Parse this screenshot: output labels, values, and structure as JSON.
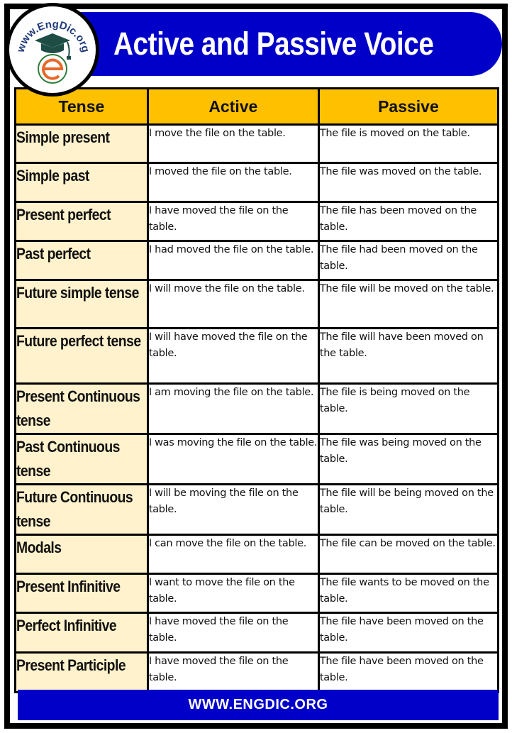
{
  "header": {
    "title": "Active and Passive Voice",
    "logo": {
      "ring_text": "www.EngDic.org",
      "icon": "graduation-cap-e-logo",
      "colors": {
        "ring_text": "#1f3a7a",
        "cap": "#1d4d45",
        "letter_e": "#e8692a",
        "circle_border": "#000000"
      }
    },
    "banner_color": "#0000c8"
  },
  "table": {
    "columns": [
      "Tense",
      "Active",
      "Passive"
    ],
    "header_color": "#ffc000",
    "tense_cell_color": "#fff2cc",
    "rows": [
      {
        "tense": "Simple present",
        "active": "I move the file on the table.",
        "passive": "The file is moved on the table."
      },
      {
        "tense": "Simple past",
        "active": "I moved the file on the table.",
        "passive": "The file was moved on the table."
      },
      {
        "tense": "Present perfect",
        "active": "I have moved the file on the table.",
        "passive": "The file has been moved on the table."
      },
      {
        "tense": "Past perfect",
        "active": "I had moved the file on the table.",
        "passive": "The file had been moved on the table."
      },
      {
        "tense": "Future simple tense",
        "active": "I will move the file on the table.",
        "passive": "The file will be moved on the table."
      },
      {
        "tense": "Future perfect tense",
        "active": "I will have moved the file on the table.",
        "passive": "The file will have been moved on the table."
      },
      {
        "tense": "Present Continuous tense",
        "active": "I am moving the file on the table.",
        "passive": "The file is being moved on the table."
      },
      {
        "tense": "Past Continuous tense",
        "active": "I was moving the file on the table.",
        "passive": "The file was being moved on the table."
      },
      {
        "tense": "Future Continuous tense",
        "active": "I will be moving the file on the table.",
        "passive": "The file will be being moved on the table."
      },
      {
        "tense": "Modals",
        "active": "I can move the file on the table.",
        "passive": "The file can be moved on the table."
      },
      {
        "tense": "Present Infinitive",
        "active": "I want to move the file on the table.",
        "passive": "The file wants to be moved on the table."
      },
      {
        "tense": "Perfect Infinitive",
        "active": "I have moved the file on the table.",
        "passive": "The file have been moved on the table."
      },
      {
        "tense": "Present Participle",
        "active": "I have moved the file on the table.",
        "passive": "The file have been moved on the table."
      }
    ]
  },
  "footer": {
    "text": "WWW.ENGDIC.ORG",
    "color": "#0000c8"
  }
}
